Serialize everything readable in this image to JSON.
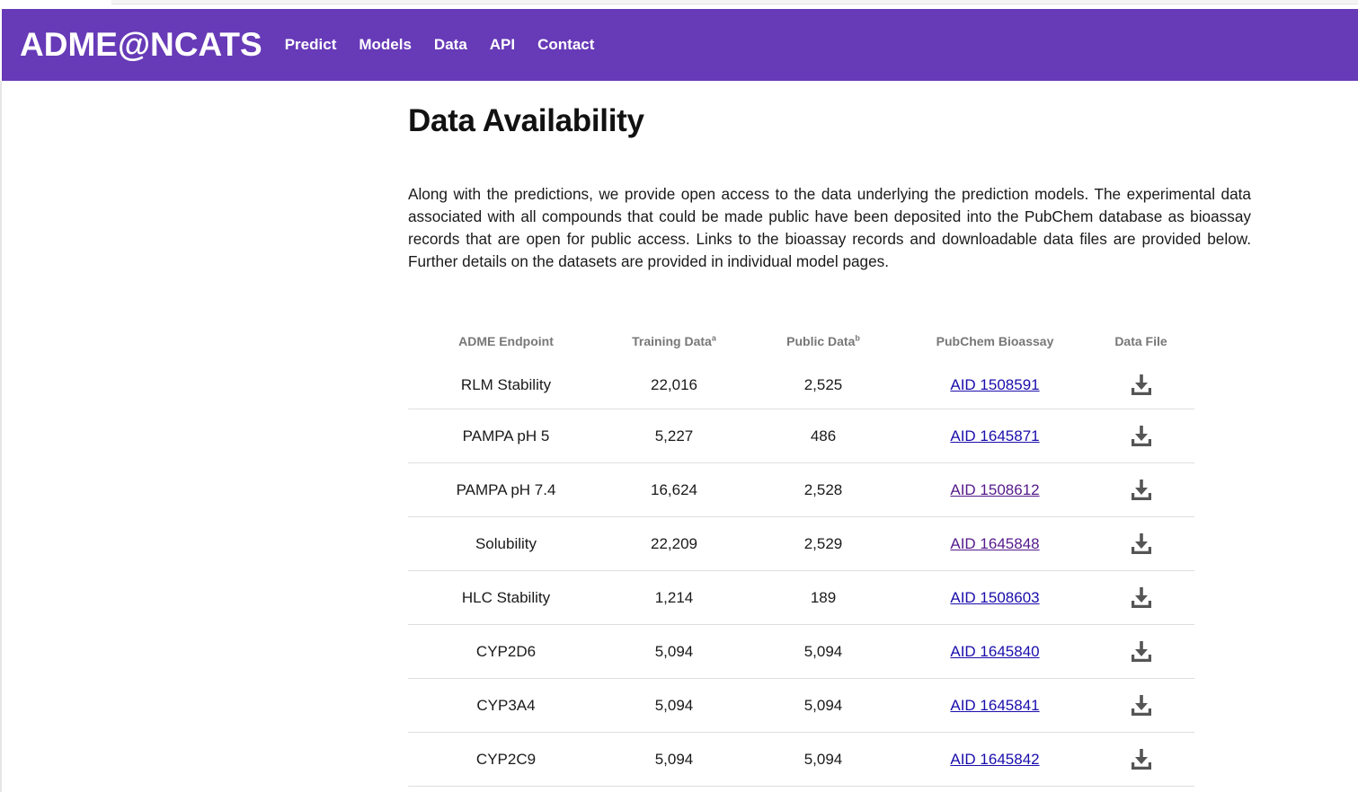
{
  "navbar": {
    "brand": "ADME@NCATS",
    "links": [
      "Predict",
      "Models",
      "Data",
      "API",
      "Contact"
    ],
    "background": "#673ab7"
  },
  "main": {
    "title": "Data Availability",
    "intro": "Along with the predictions, we provide open access to the data underlying the prediction models. The experimental data associated with all compounds that could be made public have been deposited into the PubChem database as bioassay records that are open for public access. Links to the bioassay records and downloadable data files are provided below. Further details on the datasets are provided in individual model pages."
  },
  "table": {
    "headers": {
      "endpoint": "ADME Endpoint",
      "training": "Training Data",
      "training_sup": "a",
      "public": "Public Data",
      "public_sup": "b",
      "pubchem": "PubChem Bioassay",
      "file": "Data File"
    },
    "rows": [
      {
        "endpoint": "RLM Stability",
        "training": "22,016",
        "public": "2,525",
        "aid": "AID 1508591",
        "visited": false,
        "file_icon": "download-icon"
      },
      {
        "endpoint": "PAMPA pH 5",
        "training": "5,227",
        "public": "486",
        "aid": "AID 1645871",
        "visited": false,
        "file_icon": "download-icon"
      },
      {
        "endpoint": "PAMPA pH 7.4",
        "training": "16,624",
        "public": "2,528",
        "aid": "AID 1508612",
        "visited": true,
        "file_icon": "download-icon"
      },
      {
        "endpoint": "Solubility",
        "training": "22,209",
        "public": "2,529",
        "aid": "AID 1645848",
        "visited": true,
        "file_icon": "download-icon"
      },
      {
        "endpoint": "HLC Stability",
        "training": "1,214",
        "public": "189",
        "aid": "AID 1508603",
        "visited": false,
        "file_icon": "download-icon"
      },
      {
        "endpoint": "CYP2D6",
        "training": "5,094",
        "public": "5,094",
        "aid": "AID 1645840",
        "visited": false,
        "file_icon": "download-icon"
      },
      {
        "endpoint": "CYP3A4",
        "training": "5,094",
        "public": "5,094",
        "aid": "AID 1645841",
        "visited": false,
        "file_icon": "download-icon"
      },
      {
        "endpoint": "CYP2C9",
        "training": "5,094",
        "public": "5,094",
        "aid": "AID 1645842",
        "visited": false,
        "file_icon": "download-icon"
      }
    ]
  },
  "colors": {
    "link": "#1a0dab",
    "link_visited": "#551a8b",
    "header_text": "#777777",
    "icon": "#555555"
  }
}
